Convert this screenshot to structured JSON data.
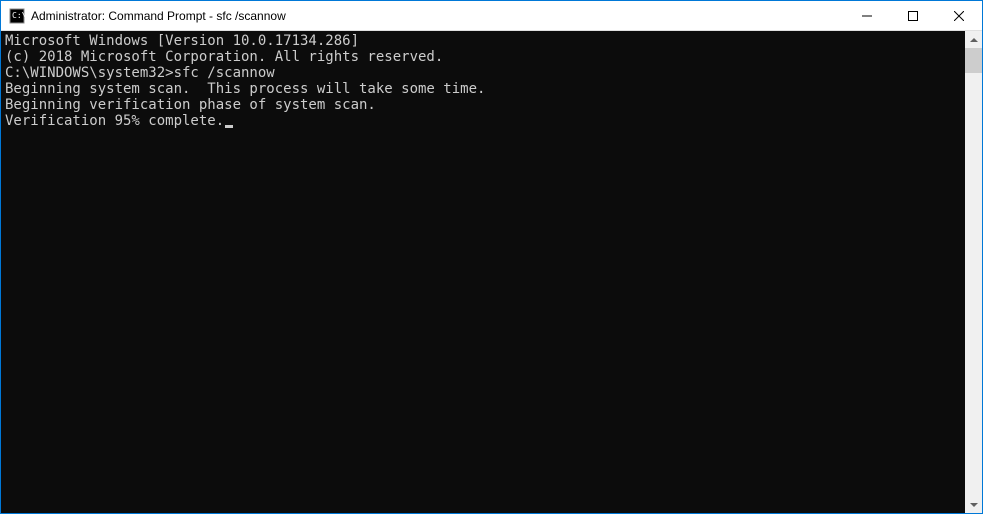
{
  "window": {
    "title": "Administrator: Command Prompt - sfc  /scannow"
  },
  "console": {
    "lines": [
      "Microsoft Windows [Version 10.0.17134.286]",
      "(c) 2018 Microsoft Corporation. All rights reserved.",
      "",
      "C:\\WINDOWS\\system32>sfc /scannow",
      "",
      "Beginning system scan.  This process will take some time.",
      "",
      "Beginning verification phase of system scan.",
      "Verification 95% complete."
    ]
  }
}
